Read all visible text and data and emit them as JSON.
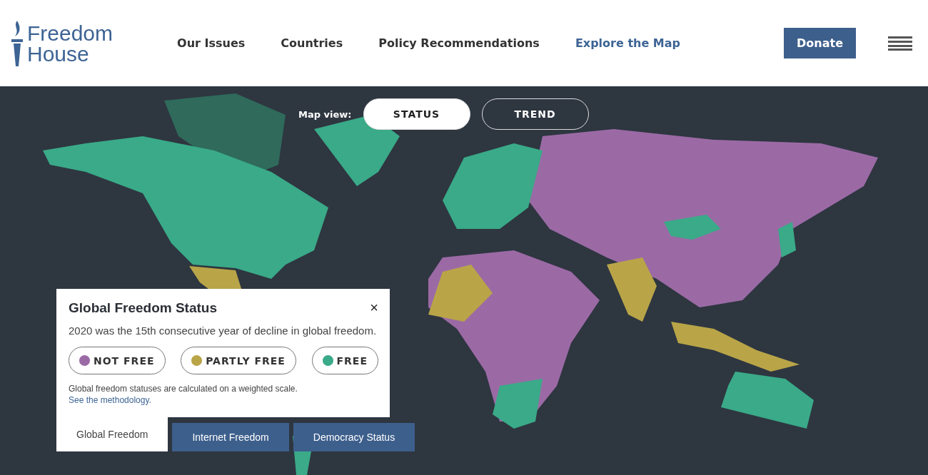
{
  "header": {
    "logo": {
      "line1": "Freedom",
      "line2": "House"
    },
    "nav": [
      {
        "label": "Our Issues",
        "selected": false
      },
      {
        "label": "Countries",
        "selected": false
      },
      {
        "label": "Policy Recommendations",
        "selected": false
      },
      {
        "label": "Explore the Map",
        "selected": true
      }
    ],
    "donate": "Donate"
  },
  "map_view": {
    "label": "Map view:",
    "options": [
      {
        "label": "STATUS",
        "selected": true
      },
      {
        "label": "TREND",
        "selected": false
      }
    ]
  },
  "panel": {
    "title": "Global Freedom Status",
    "close": "×",
    "summary": "2020 was the 15th consecutive year of decline in global freedom.",
    "legend": [
      {
        "label": "NOT FREE",
        "color": "#9b6aa5"
      },
      {
        "label": "PARTLY FREE",
        "color": "#b9a548"
      },
      {
        "label": "FREE",
        "color": "#3aaa88"
      }
    ],
    "note": "Global freedom statuses are calculated on a weighted scale.",
    "note_link": "See the methodology."
  },
  "tabs": [
    {
      "label": "Global Freedom",
      "selected": true
    },
    {
      "label": "Internet Freedom",
      "selected": false
    },
    {
      "label": "Democracy Status",
      "selected": false
    }
  ]
}
